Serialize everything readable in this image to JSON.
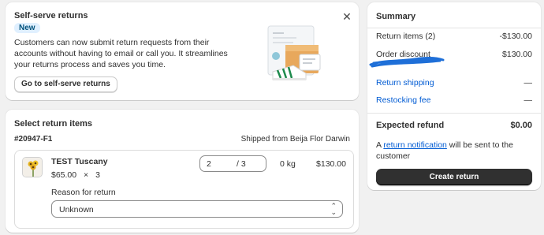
{
  "self_serve": {
    "title": "Self-serve returns",
    "badge": "New",
    "description": "Customers can now submit return requests from their accounts without having to email or call you. It streamlines your returns process and saves you time.",
    "button_label": "Go to self-serve returns",
    "close_icon": "close-icon"
  },
  "return_items": {
    "title": "Select return items",
    "order_number": "#20947-F1",
    "shipped_from": "Shipped from Beija Flor Darwin",
    "item": {
      "name": "TEST Tuscany",
      "unit_price": "$65.00",
      "times": "×",
      "quantity": "3",
      "qty_value": "2",
      "qty_total": "/ 3",
      "weight": "0 kg",
      "line_price": "$130.00",
      "reason_label": "Reason for return",
      "reason_value": "Unknown"
    }
  },
  "summary": {
    "title": "Summary",
    "return_items_label": "Return items (2)",
    "return_items_value": "-$130.00",
    "order_discount_label": "Order discount",
    "order_discount_value": "$130.00",
    "return_shipping_label": "Return shipping",
    "return_shipping_value": "—",
    "restocking_fee_label": "Restocking fee",
    "restocking_fee_value": "—",
    "expected_refund_label": "Expected refund",
    "expected_refund_value": "$0.00",
    "note_prefix": "A ",
    "note_link": "return notification",
    "note_suffix": " will be sent to the customer",
    "create_button": "Create return"
  },
  "colors": {
    "link": "#005bd3",
    "badge_bg": "#e0f0ff",
    "primary_button": "#303030",
    "scribble": "#1e6fd8"
  }
}
